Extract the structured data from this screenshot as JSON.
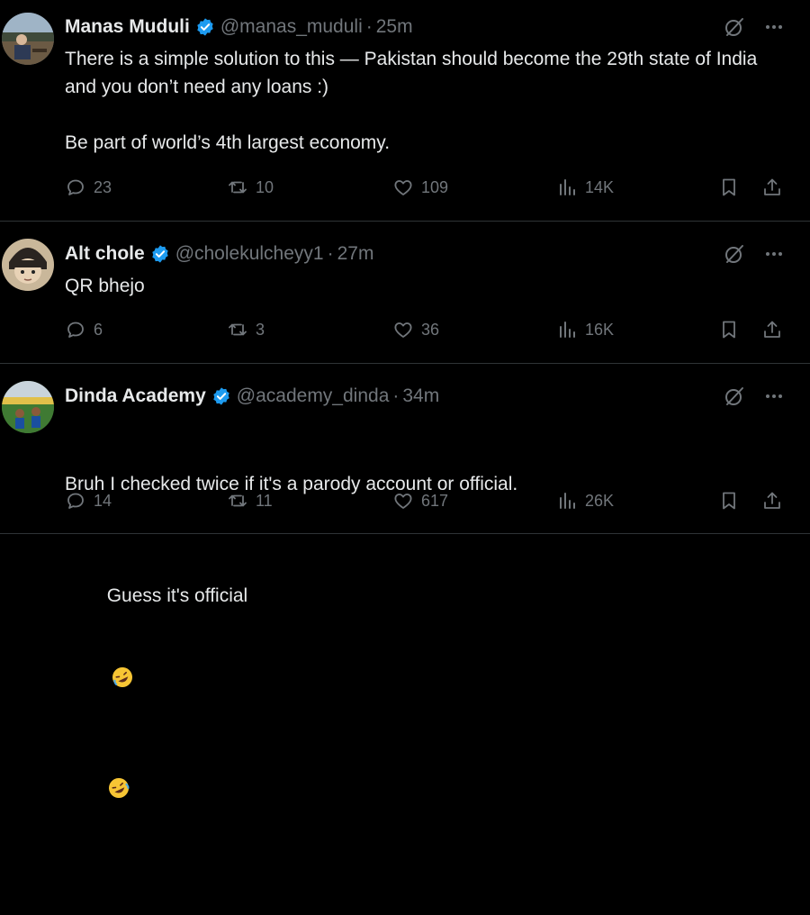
{
  "colors": {
    "background": "#000000",
    "text": "#e7e9ea",
    "muted": "#71767b",
    "verified_blue": "#1d9bf0",
    "divider": "#2f3336"
  },
  "tweets": [
    {
      "name": "Manas Muduli",
      "handle": "@manas_muduli",
      "dot": "·",
      "time": "25m",
      "text": "There is a simple solution to this — Pakistan should become the 29th state of India and you don’t need any loans :)\n\nBe part of world’s 4th largest economy.",
      "replies": "23",
      "reposts": "10",
      "likes": "109",
      "views": "14K",
      "icons": {
        "verified": "verified-badge-icon",
        "grok": "grok-icon",
        "more": "more-icon"
      }
    },
    {
      "name": "Alt chole",
      "handle": "@cholekulcheyy1",
      "dot": "·",
      "time": "27m",
      "text": "QR bhejo",
      "replies": "6",
      "reposts": "3",
      "likes": "36",
      "views": "16K",
      "icons": {
        "verified": "verified-badge-icon",
        "grok": "grok-icon",
        "more": "more-icon"
      }
    },
    {
      "name": "Dinda Academy",
      "handle": "@academy_dinda",
      "dot": "·",
      "time": "34m",
      "text_line1": "Bruh I checked twice if it's a parody account or official.",
      "text_line2": "Guess it's official",
      "replies": "14",
      "reposts": "11",
      "likes": "617",
      "views": "26K",
      "icons": {
        "verified": "verified-badge-icon",
        "grok": "grok-icon",
        "more": "more-icon",
        "emoji": "rolling-on-floor-laughing-emoji"
      }
    }
  ]
}
